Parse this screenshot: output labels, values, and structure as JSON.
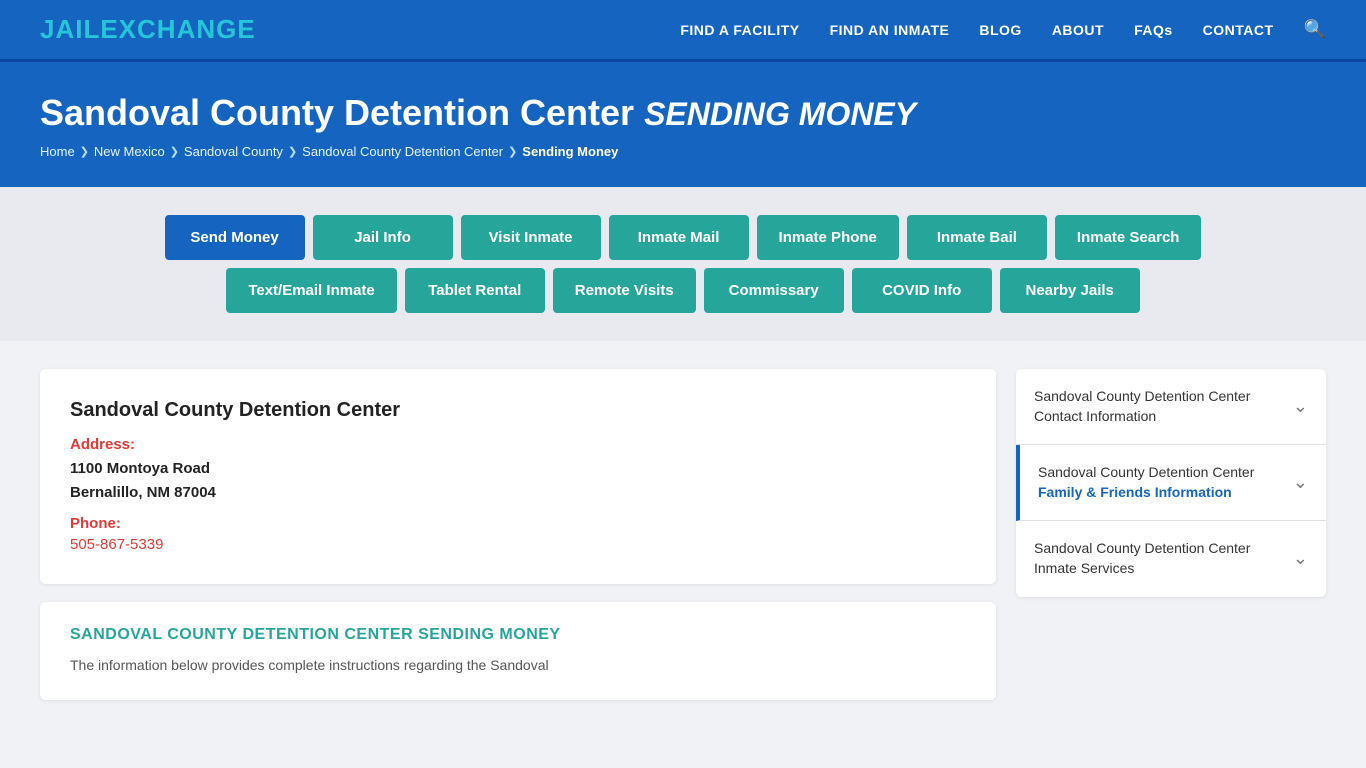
{
  "header": {
    "logo_part1": "JAIL",
    "logo_part2": "EXCHANGE",
    "nav_items": [
      {
        "label": "FIND A FACILITY",
        "href": "#"
      },
      {
        "label": "FIND AN INMATE",
        "href": "#"
      },
      {
        "label": "BLOG",
        "href": "#"
      },
      {
        "label": "ABOUT",
        "href": "#"
      },
      {
        "label": "FAQs",
        "href": "#"
      },
      {
        "label": "CONTACT",
        "href": "#"
      }
    ]
  },
  "hero": {
    "title": "Sandoval County Detention Center",
    "subtitle": "SENDING MONEY",
    "breadcrumb": [
      {
        "label": "Home",
        "href": "#"
      },
      {
        "label": "New Mexico",
        "href": "#"
      },
      {
        "label": "Sandoval County",
        "href": "#"
      },
      {
        "label": "Sandoval County Detention Center",
        "href": "#"
      },
      {
        "label": "Sending Money",
        "current": true
      }
    ]
  },
  "tabs_row1": [
    {
      "label": "Send Money",
      "active": true
    },
    {
      "label": "Jail Info",
      "active": false
    },
    {
      "label": "Visit Inmate",
      "active": false
    },
    {
      "label": "Inmate Mail",
      "active": false
    },
    {
      "label": "Inmate Phone",
      "active": false
    },
    {
      "label": "Inmate Bail",
      "active": false
    },
    {
      "label": "Inmate Search",
      "active": false
    }
  ],
  "tabs_row2": [
    {
      "label": "Text/Email Inmate",
      "active": false
    },
    {
      "label": "Tablet Rental",
      "active": false
    },
    {
      "label": "Remote Visits",
      "active": false
    },
    {
      "label": "Commissary",
      "active": false
    },
    {
      "label": "COVID Info",
      "active": false
    },
    {
      "label": "Nearby Jails",
      "active": false
    }
  ],
  "info_card": {
    "facility_name": "Sandoval County Detention Center",
    "address_label": "Address:",
    "address_line1": "1100 Montoya Road",
    "address_line2": "Bernalillo, NM 87004",
    "phone_label": "Phone:",
    "phone": "505-867-5339"
  },
  "section_card": {
    "title": "SANDOVAL COUNTY DETENTION CENTER SENDING MONEY",
    "body": "The information below provides complete instructions regarding the Sandoval"
  },
  "sidebar": {
    "items": [
      {
        "line1": "Sandoval County Detention Center",
        "line2": "Contact Information",
        "highlight": false,
        "active": false
      },
      {
        "line1": "Sandoval County Detention Center",
        "line2": "Family & Friends Information",
        "highlight": true,
        "active": true
      },
      {
        "line1": "Sandoval County Detention Center",
        "line2": "Inmate Services",
        "highlight": false,
        "active": false
      }
    ]
  }
}
